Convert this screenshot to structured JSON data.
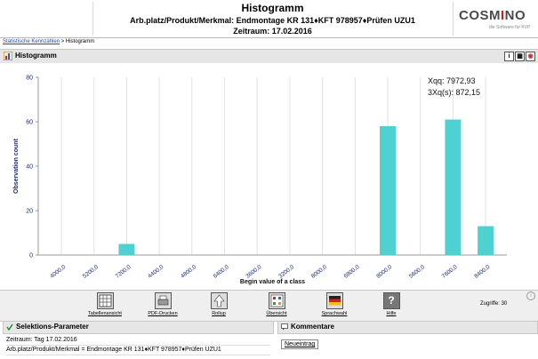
{
  "header": {
    "title": "Histogramm",
    "line1": "Arb.platz/Produkt/Merkmal: Endmontage KR 131♦KFT 978957♦Prüfen UZU1",
    "line2": "Zeitraum: 17.02.2016",
    "logo": {
      "pre": "COSM",
      "accent": "I",
      "post": "NO",
      "tagline": "die Software für KVP"
    }
  },
  "breadcrumb": {
    "link": "Statistische Kennzahlen",
    "separator": " > ",
    "current": "Histogramm"
  },
  "panel": {
    "title": "Histogramm",
    "tools": [
      "info-icon",
      "export-icon",
      "settings-icon"
    ]
  },
  "chart_data": {
    "type": "bar",
    "xlabel": "Begin value of a class",
    "ylabel": "Observation count",
    "ylim": [
      0,
      80
    ],
    "yticks": [
      0,
      20,
      40,
      60,
      80
    ],
    "categories": [
      "4000,0",
      "5200,0",
      "7200,0",
      "4400,0",
      "4800,0",
      "6400,0",
      "3600,0",
      "3200,0",
      "8000,0",
      "6800,0",
      "8000,0",
      "5600,0",
      "7600,0",
      "8400,0"
    ],
    "values": [
      0,
      0,
      5,
      0,
      0,
      0,
      0,
      0,
      0,
      0,
      58,
      0,
      61,
      13
    ],
    "annotations": [
      "Xqq: 7972,93",
      "3Xq(s): 872,15"
    ],
    "bar_color": "#4fd1d1",
    "grid": "vertical"
  },
  "toolbar": {
    "buttons": [
      {
        "label": "Tabellenansicht",
        "icon": "table-icon"
      },
      {
        "label": "PDF-Drucken",
        "icon": "printer-icon"
      },
      {
        "label": "Rollup",
        "icon": "arrow-up-icon"
      },
      {
        "label": "Übersicht",
        "icon": "overview-icon"
      },
      {
        "label": "Sprachwahl",
        "icon": "flag-icon"
      },
      {
        "label": "Hilfe",
        "icon": "help-icon"
      }
    ],
    "zugriffe": "Zugriffe: 30"
  },
  "selection": {
    "title": "Selektions-Parameter",
    "zeitraum": "Zeitraum: Tag 17.02.2016",
    "merkmal": "Arb.platz/Produkt/Merkmal = Endmontage KR 131♦KFT 978957♦Prüfen UZU1"
  },
  "comments": {
    "title": "Kommentare",
    "new_entry": "Neueintrag"
  }
}
